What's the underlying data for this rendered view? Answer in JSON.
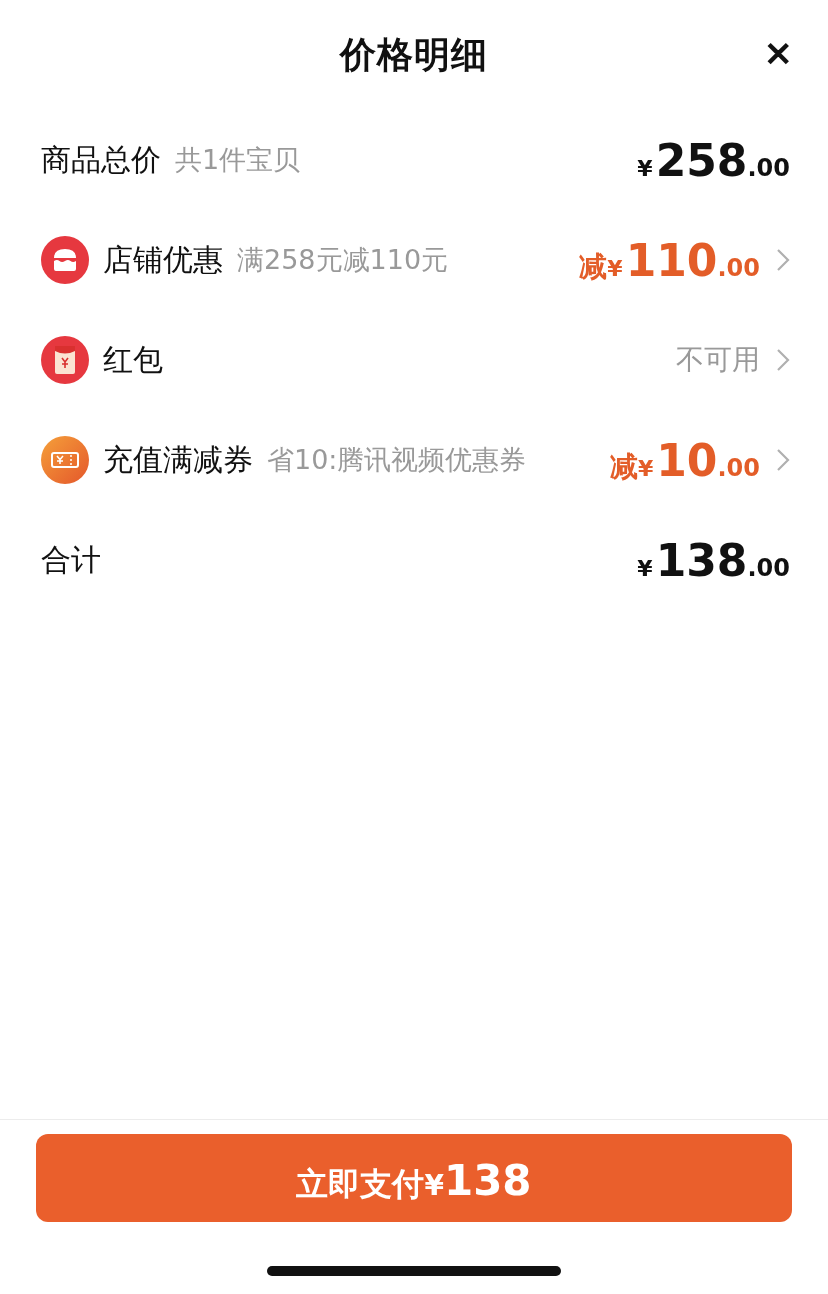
{
  "header": {
    "title": "价格明细",
    "close": "✕"
  },
  "rows": [
    {
      "kind": "plain",
      "label": "商品总价",
      "note": "共1件宝贝",
      "prefix": "",
      "currency": "¥",
      "amount": "258",
      "decimals": ".00"
    },
    {
      "kind": "discount",
      "label": "店铺优惠",
      "note": "满258元减110元",
      "prefix": "减",
      "currency": "¥",
      "amount": "110",
      "decimals": ".00"
    },
    {
      "kind": "unavailable",
      "label": "红包",
      "note": "",
      "status": "不可用"
    },
    {
      "kind": "discount",
      "label": "充值满减券",
      "note": "省10:腾讯视频优惠券",
      "prefix": "减",
      "currency": "¥",
      "amount": "10",
      "decimals": ".00"
    },
    {
      "kind": "plain",
      "label": "合计",
      "note": "",
      "prefix": "",
      "currency": "¥",
      "amount": "138",
      "decimals": ".00"
    }
  ],
  "pay_button": {
    "label": "立即支付",
    "currency": "¥",
    "amount": "138"
  }
}
